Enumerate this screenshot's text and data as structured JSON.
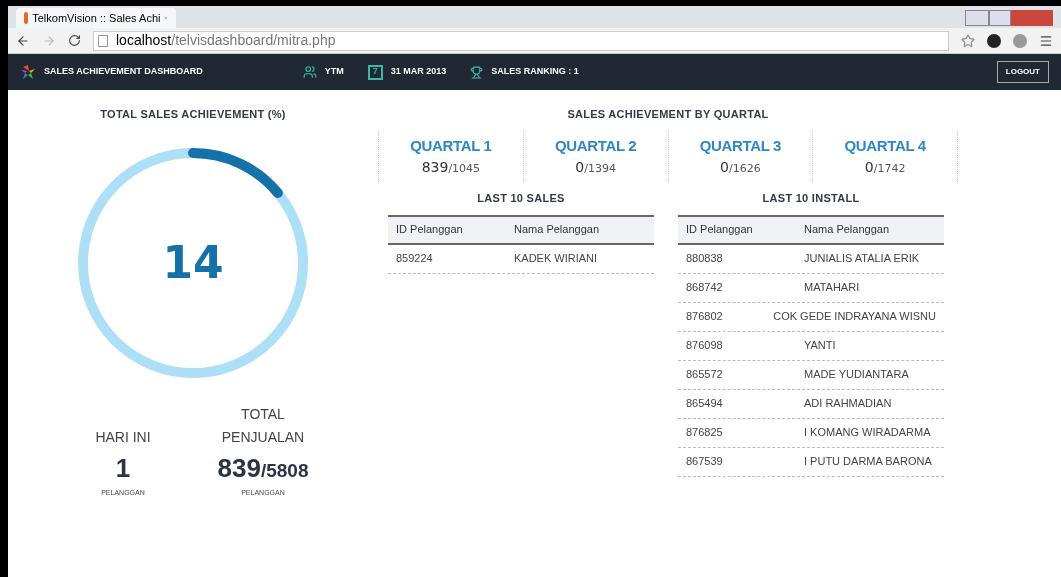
{
  "browser": {
    "tab_title": "TelkomVision :: Sales Achi",
    "url_host": "localhost",
    "url_path": "/telvisdashboard/mitra.php"
  },
  "navbar": {
    "title": "SALES ACHIEVEMENT DASHBOARD",
    "user": "YTM",
    "date": "31 MAR 2013",
    "date_day": "7",
    "ranking": "SALES RANKING : 1",
    "logout": "LOGOUT"
  },
  "total": {
    "heading": "TOTAL SALES ACHIEVEMENT (%)",
    "value": "14",
    "level": 0.14,
    "stats": [
      {
        "label": "HARI INI",
        "value": "1",
        "unit": "PELANGGAN"
      },
      {
        "label": "TOTAL PENJUALAN",
        "value": "839",
        "target": "/5808",
        "unit": "PELANGGAN"
      }
    ]
  },
  "quartal": {
    "heading": "SALES ACHIEVEMENT BY QUARTAL",
    "items": [
      {
        "label": "QUARTAL 1",
        "value": "839",
        "target": "/1045"
      },
      {
        "label": "QUARTAL 2",
        "value": "0",
        "target": "/1394"
      },
      {
        "label": "QUARTAL 3",
        "value": "0",
        "target": "/1626"
      },
      {
        "label": "QUARTAL 4",
        "value": "0",
        "target": "/1742"
      }
    ]
  },
  "tables": [
    {
      "title": "LAST 10 SALES",
      "columns": [
        "ID Pelanggan",
        "Nama Pelanggan"
      ],
      "rows": [
        [
          "859224",
          "KADEK WIRIANI"
        ]
      ]
    },
    {
      "title": "LAST 10 INSTALL",
      "columns": [
        "ID Pelanggan",
        "Nama Pelanggan"
      ],
      "rows": [
        [
          "880838",
          "JUNIALIS ATALIA ERIK"
        ],
        [
          "868742",
          "MATAHARI"
        ],
        [
          "876802",
          "COK GEDE INDRAYANA WISNU"
        ],
        [
          "876098",
          "YANTI"
        ],
        [
          "865572",
          "MADE YUDIANTARA"
        ],
        [
          "865494",
          "ADI RAHMADIAN"
        ],
        [
          "876825",
          "I KOMANG WIRADARMA"
        ],
        [
          "867539",
          "I PUTU DARMA BARONA"
        ]
      ]
    }
  ]
}
